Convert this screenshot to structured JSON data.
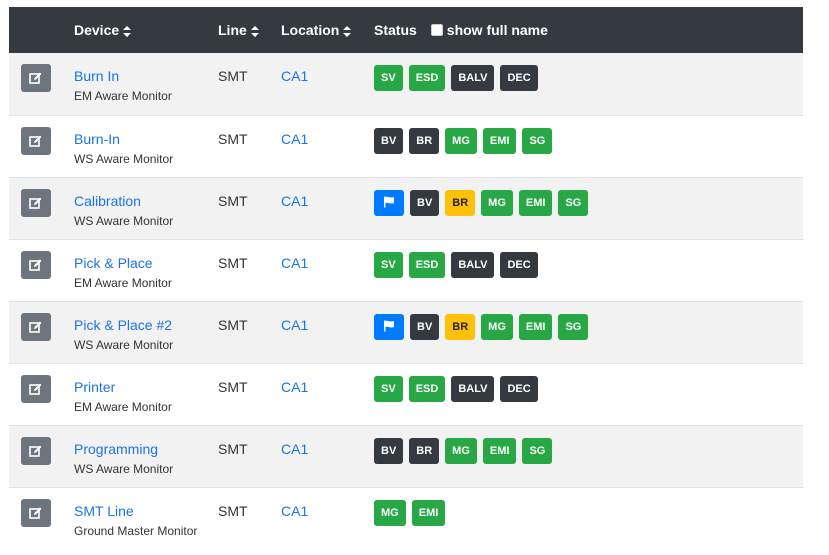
{
  "header": {
    "device": "Device",
    "line": "Line",
    "location": "Location",
    "status": "Status",
    "show_full_name": "show full name"
  },
  "rows": [
    {
      "name": "Burn In",
      "monitor": "EM Aware Monitor",
      "line": "SMT",
      "location": "CA1",
      "badges": [
        {
          "label": "SV",
          "color": "green"
        },
        {
          "label": "ESD",
          "color": "green"
        },
        {
          "label": "BALV",
          "color": "dark"
        },
        {
          "label": "DEC",
          "color": "dark"
        }
      ]
    },
    {
      "name": "Burn-In",
      "monitor": "WS Aware Monitor",
      "line": "SMT",
      "location": "CA1",
      "badges": [
        {
          "label": "BV",
          "color": "dark"
        },
        {
          "label": "BR",
          "color": "dark"
        },
        {
          "label": "MG",
          "color": "green"
        },
        {
          "label": "EMI",
          "color": "green"
        },
        {
          "label": "SG",
          "color": "green"
        }
      ]
    },
    {
      "name": "Calibration",
      "monitor": "WS Aware Monitor",
      "line": "SMT",
      "location": "CA1",
      "badges": [
        {
          "label": "",
          "color": "flag",
          "icon": "flag-icon"
        },
        {
          "label": "BV",
          "color": "dark"
        },
        {
          "label": "BR",
          "color": "yellow"
        },
        {
          "label": "MG",
          "color": "green"
        },
        {
          "label": "EMI",
          "color": "green"
        },
        {
          "label": "SG",
          "color": "green"
        }
      ]
    },
    {
      "name": "Pick & Place",
      "monitor": "EM Aware Monitor",
      "line": "SMT",
      "location": "CA1",
      "badges": [
        {
          "label": "SV",
          "color": "green"
        },
        {
          "label": "ESD",
          "color": "green"
        },
        {
          "label": "BALV",
          "color": "dark"
        },
        {
          "label": "DEC",
          "color": "dark"
        }
      ]
    },
    {
      "name": "Pick & Place #2",
      "monitor": "WS Aware Monitor",
      "line": "SMT",
      "location": "CA1",
      "badges": [
        {
          "label": "",
          "color": "flag",
          "icon": "flag-icon"
        },
        {
          "label": "BV",
          "color": "dark"
        },
        {
          "label": "BR",
          "color": "yellow"
        },
        {
          "label": "MG",
          "color": "green"
        },
        {
          "label": "EMI",
          "color": "green"
        },
        {
          "label": "SG",
          "color": "green"
        }
      ]
    },
    {
      "name": "Printer",
      "monitor": "EM Aware Monitor",
      "line": "SMT",
      "location": "CA1",
      "badges": [
        {
          "label": "SV",
          "color": "green"
        },
        {
          "label": "ESD",
          "color": "green"
        },
        {
          "label": "BALV",
          "color": "dark"
        },
        {
          "label": "DEC",
          "color": "dark"
        }
      ]
    },
    {
      "name": "Programming",
      "monitor": "WS Aware Monitor",
      "line": "SMT",
      "location": "CA1",
      "badges": [
        {
          "label": "BV",
          "color": "dark"
        },
        {
          "label": "BR",
          "color": "dark"
        },
        {
          "label": "MG",
          "color": "green"
        },
        {
          "label": "EMI",
          "color": "green"
        },
        {
          "label": "SG",
          "color": "green"
        }
      ]
    },
    {
      "name": "SMT Line",
      "monitor": "Ground Master Monitor",
      "line": "SMT",
      "location": "CA1",
      "badges": [
        {
          "label": "MG",
          "color": "green"
        },
        {
          "label": "EMI",
          "color": "green"
        }
      ]
    }
  ],
  "colors": {
    "green": "#28a745",
    "dark": "#343a40",
    "yellow": "#ffc107",
    "flag": "#007bff",
    "link": "#1a73e8",
    "header_bg": "#343a40"
  },
  "show_full_name_checked": false
}
